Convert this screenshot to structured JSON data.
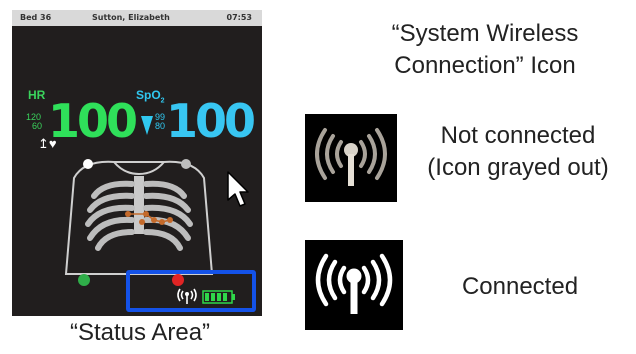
{
  "monitor": {
    "bed": "Bed 36",
    "patient_name": "Sutton, Elizabeth",
    "time": "07:53",
    "hr": {
      "label": "HR",
      "value": "100",
      "limit_high": "120",
      "limit_low": "60"
    },
    "spo2": {
      "label": "SpO",
      "label_sub": "2",
      "value": "100",
      "limit_high": "99",
      "limit_low": "80"
    },
    "battery_level": 1.0,
    "icons": [
      "heart-icon",
      "pulse-wave-icon",
      "wireless-icon",
      "battery-icon",
      "cursor-icon"
    ]
  },
  "captions": {
    "status_area": "“Status Area”",
    "title_line1": "“System Wireless",
    "title_line2": "Connection” Icon",
    "not_connected_line1": "Not connected",
    "not_connected_line2": "(Icon grayed out)",
    "connected": "Connected"
  },
  "colors": {
    "hr": "#2fe05a",
    "spo2": "#38c6f2",
    "highlight": "#1452e8",
    "icon_grayed": "#a9a39a",
    "icon_active": "#ffffff",
    "battery": "#2fd84a"
  }
}
